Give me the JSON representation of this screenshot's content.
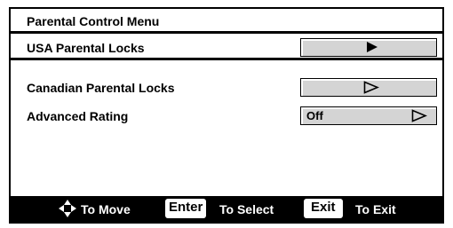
{
  "menu": {
    "title": "Parental Control Menu",
    "items": [
      {
        "label": "USA Parental Locks",
        "value": ""
      },
      {
        "label": "Canadian Parental Locks",
        "value": ""
      },
      {
        "label": "Advanced Rating",
        "value": "Off"
      }
    ]
  },
  "footer": {
    "move_label": "To Move",
    "enter_key": "Enter",
    "select_label": "To Select",
    "exit_key": "Exit",
    "exit_label": "To Exit"
  },
  "icons": {
    "move": "four-way-arrow-icon",
    "open": "play-triangle-icon",
    "open_hollow": "hollow-triangle-icon"
  }
}
